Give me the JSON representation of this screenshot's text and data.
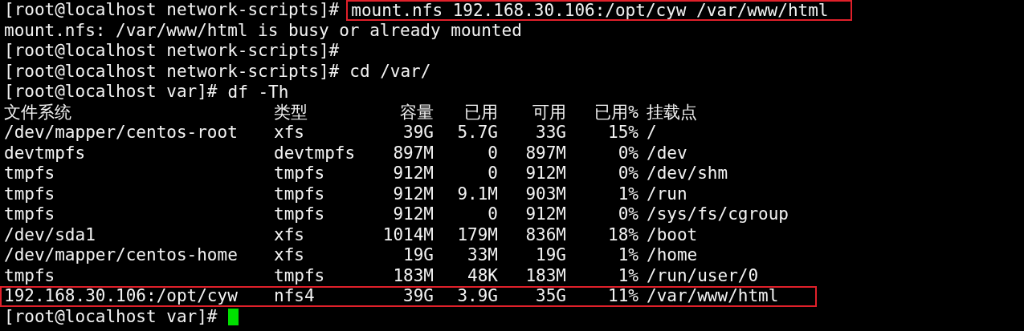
{
  "lines": [
    {
      "kind": "command",
      "prompt": "[root@localhost network-scripts]#",
      "command": "mount.nfs 192.168.30.106:/opt/cyw /var/www/html",
      "highlighted": true
    },
    {
      "kind": "output",
      "text": "mount.nfs: /var/www/html is busy or already mounted"
    },
    {
      "kind": "command",
      "prompt": "[root@localhost network-scripts]#"
    },
    {
      "kind": "command",
      "prompt": "[root@localhost network-scripts]#",
      "command": "cd /var/"
    },
    {
      "kind": "command",
      "prompt": "[root@localhost var]#",
      "command": "df -Th"
    }
  ],
  "df": {
    "columns": [
      "文件系统",
      "类型",
      "容量",
      "已用",
      "可用",
      "已用%",
      "挂载点"
    ],
    "rows": [
      {
        "cells": [
          "/dev/mapper/centos-root",
          "xfs",
          "39G",
          "5.7G",
          "33G",
          "15%",
          "/"
        ]
      },
      {
        "cells": [
          "devtmpfs",
          "devtmpfs",
          "897M",
          "0",
          "897M",
          "0%",
          "/dev"
        ]
      },
      {
        "cells": [
          "tmpfs",
          "tmpfs",
          "912M",
          "0",
          "912M",
          "0%",
          "/dev/shm"
        ]
      },
      {
        "cells": [
          "tmpfs",
          "tmpfs",
          "912M",
          "9.1M",
          "903M",
          "1%",
          "/run"
        ]
      },
      {
        "cells": [
          "tmpfs",
          "tmpfs",
          "912M",
          "0",
          "912M",
          "0%",
          "/sys/fs/cgroup"
        ]
      },
      {
        "cells": [
          "/dev/sda1",
          "xfs",
          "1014M",
          "179M",
          "836M",
          "18%",
          "/boot"
        ]
      },
      {
        "cells": [
          "/dev/mapper/centos-home",
          "xfs",
          "19G",
          "33M",
          "19G",
          "1%",
          "/home"
        ]
      },
      {
        "cells": [
          "tmpfs",
          "tmpfs",
          "183M",
          "48K",
          "183M",
          "1%",
          "/run/user/0"
        ]
      },
      {
        "cells": [
          "192.168.30.106:/opt/cyw",
          "nfs4",
          "39G",
          "3.9G",
          "35G",
          "11%",
          "/var/www/html"
        ],
        "highlighted": true
      }
    ]
  },
  "final_prompt": {
    "prompt": "[root@localhost var]#",
    "cursor": true
  }
}
